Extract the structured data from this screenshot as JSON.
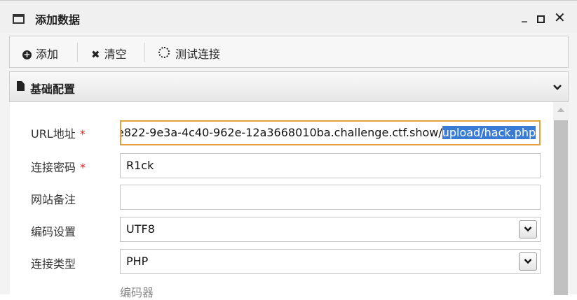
{
  "window": {
    "title": "添加数据",
    "minimize_glyph": "_",
    "close_glyph": "✕"
  },
  "toolbar": {
    "add_label": "添加",
    "clear_label": "清空",
    "test_label": "测试连接"
  },
  "section": {
    "title": "基础配置",
    "chevron": "⌄"
  },
  "form": {
    "url": {
      "label": "URL地址",
      "required": "*",
      "value_prefix": "e822-9e3a-4c40-962e-12a3668010ba.challenge.ctf.show/",
      "value_selected": "upload/hack.php"
    },
    "password": {
      "label": "连接密码",
      "required": "*",
      "value": "R1ck"
    },
    "note": {
      "label": "网站备注",
      "value": ""
    },
    "encoding": {
      "label": "编码设置",
      "value": "UTF8"
    },
    "conn_type": {
      "label": "连接类型",
      "value": "PHP"
    },
    "encoder_label": "编码器"
  },
  "icons": {
    "window": "window-icon",
    "add": "plus-circle-icon",
    "clear": "x-icon",
    "test": "spinner-icon",
    "section": "document-icon",
    "dropdown": "chevron-down-icon"
  },
  "colors": {
    "focus_border": "#e0a23c",
    "selection": "#3a7bd5",
    "required": "#e02424"
  }
}
